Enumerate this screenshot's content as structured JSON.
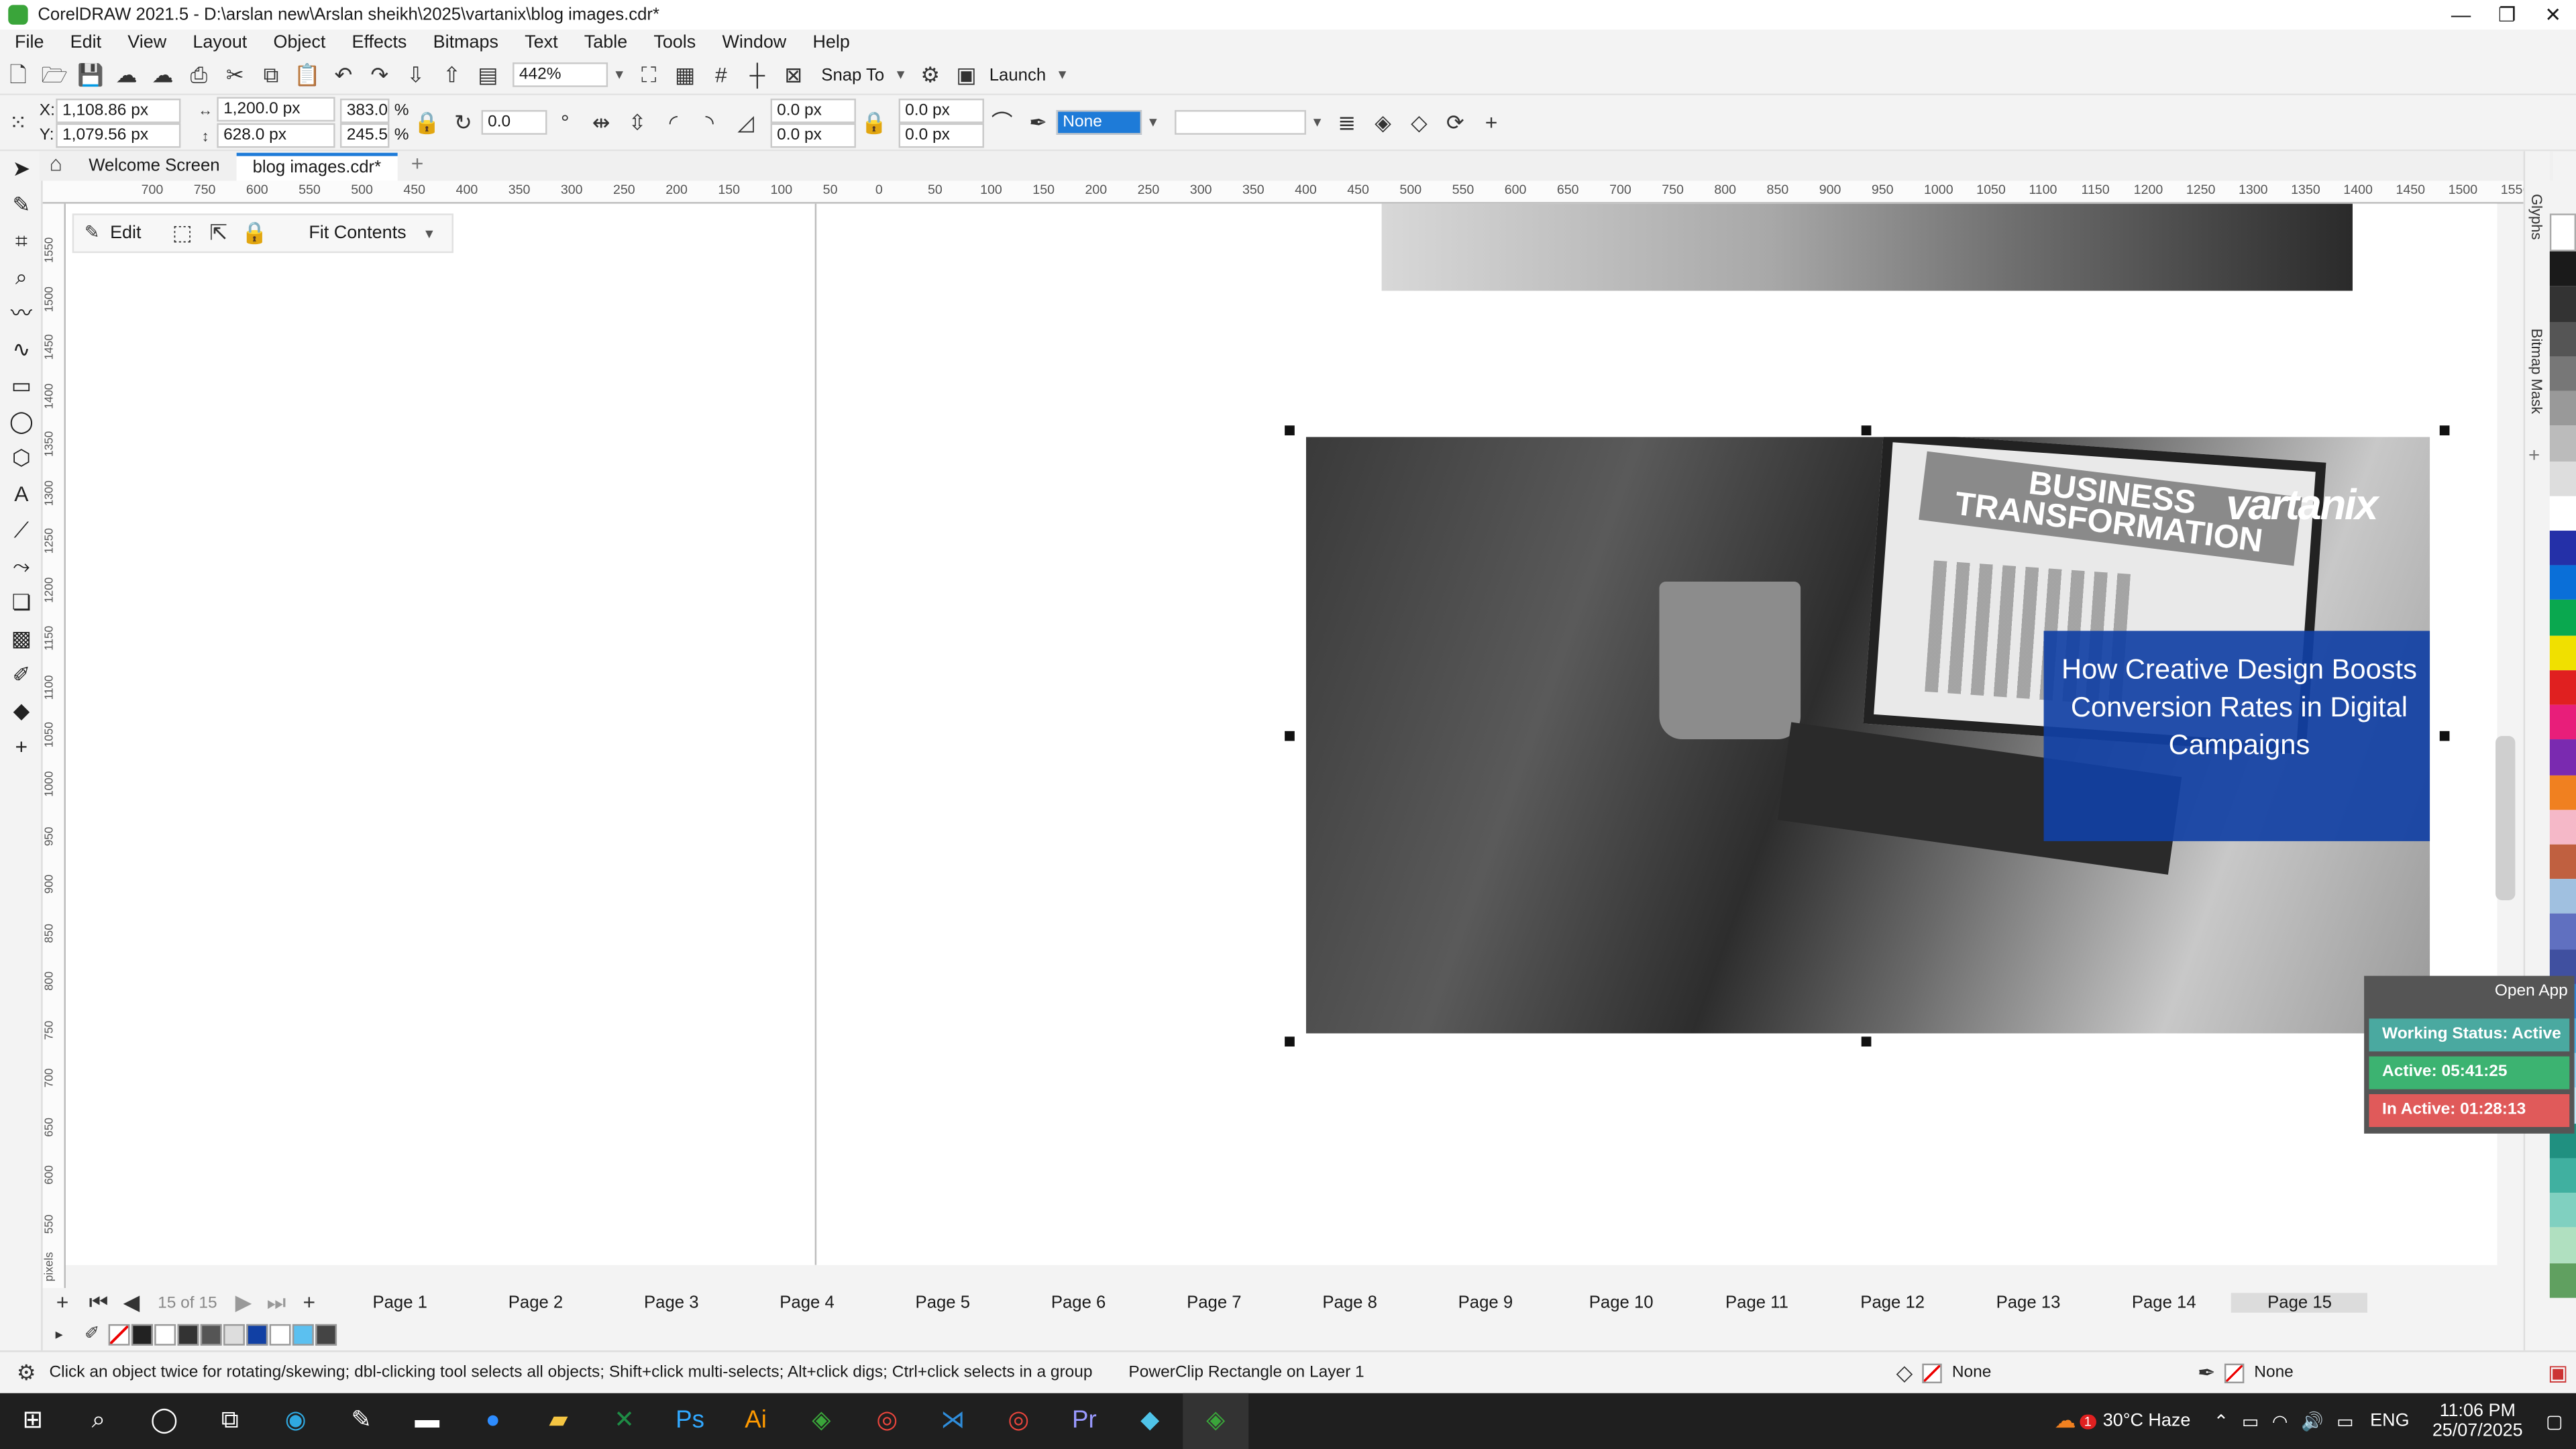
{
  "window": {
    "title": "CorelDRAW 2021.5 - D:\\arslan new\\Arslan sheikh\\2025\\vartanix\\blog images.cdr*"
  },
  "menu": [
    "File",
    "Edit",
    "View",
    "Layout",
    "Object",
    "Effects",
    "Bitmaps",
    "Text",
    "Table",
    "Tools",
    "Window",
    "Help"
  ],
  "std_toolbar": {
    "zoom": "442%",
    "snap_to": "Snap To",
    "launch": "Launch"
  },
  "property_bar": {
    "x": "1,108.86 px",
    "y": "1,079.56 px",
    "width": "1,200.0 px",
    "height": "628.0 px",
    "scale_x": "383.0",
    "scale_y": "245.5",
    "percent": "%",
    "rotation": "0.0",
    "corner_a": "0.0 px",
    "corner_b": "0.0 px",
    "corner_c": "0.0 px",
    "corner_d": "0.0 px",
    "outline": "None"
  },
  "doc_tabs": [
    "Welcome Screen",
    "blog images.cdr*"
  ],
  "powerclip_toolbar": {
    "edit": "Edit",
    "fit": "Fit Contents"
  },
  "ruler_h": [
    "700",
    "750",
    "600",
    "550",
    "500",
    "450",
    "400",
    "350",
    "300",
    "250",
    "200",
    "150",
    "100",
    "50",
    "0",
    "50",
    "100",
    "150",
    "200",
    "250",
    "300",
    "350",
    "400",
    "450",
    "500",
    "550",
    "600",
    "650",
    "700",
    "750",
    "800",
    "850",
    "900",
    "950",
    "1000",
    "1050",
    "1100",
    "1150",
    "1200",
    "1250",
    "1300",
    "1350",
    "1400",
    "1450",
    "1500",
    "1550",
    "pixels"
  ],
  "ruler_v": [
    "1550",
    "1500",
    "1450",
    "1400",
    "1350",
    "1300",
    "1250",
    "1200",
    "1150",
    "1100",
    "1050",
    "1000",
    "950",
    "900",
    "850",
    "800",
    "750",
    "700",
    "650",
    "600",
    "550",
    "pixels"
  ],
  "artwork": {
    "banner": "BUSINESS TRANSFORMATION",
    "brand": "vartanix",
    "headline": "How Creative Design Boosts Conversion Rates in Digital Campaigns"
  },
  "dockers": [
    "Glyphs",
    "Bitmap Mask"
  ],
  "page_nav": {
    "counter": "15 of 15"
  },
  "pages": [
    "Page 1",
    "Page 2",
    "Page 3",
    "Page 4",
    "Page 5",
    "Page 6",
    "Page 7",
    "Page 8",
    "Page 9",
    "Page 10",
    "Page 11",
    "Page 12",
    "Page 13",
    "Page 14",
    "Page 15"
  ],
  "status": {
    "hint": "Click an object twice for rotating/skewing; dbl-clicking tool selects all objects; Shift+click multi-selects; Alt+click digs; Ctrl+click selects in a group",
    "object": "PowerClip Rectangle on Layer 1",
    "fill": "None",
    "outline": "None"
  },
  "timer": {
    "open_app": "Open App",
    "working": "Working Status: Active",
    "active": "Active: 05:41:25",
    "inactive": "In Active: 01:28:13"
  },
  "taskbar": {
    "weather": "30°C  Haze",
    "lang": "ENG",
    "time": "11:06 PM",
    "date": "25/07/2025",
    "notif": "1"
  },
  "colors": {
    "accent": "#1e7bd8",
    "headline_bg": "#1140a4",
    "active_green": "#3cb371",
    "inactive_red": "#e05a5a",
    "working_teal": "#4aa9a0"
  }
}
